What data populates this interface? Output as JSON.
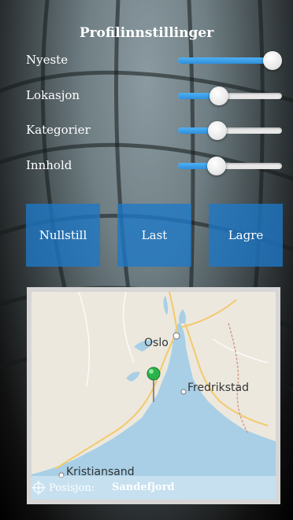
{
  "header": {
    "title": "Profilinnstillinger"
  },
  "settings": [
    {
      "label": "Nyeste",
      "value": 1.0
    },
    {
      "label": "Lokasjon",
      "value": 0.37
    },
    {
      "label": "Kategorier",
      "value": 0.35
    },
    {
      "label": "Innhold",
      "value": 0.34
    }
  ],
  "buttons": {
    "reset": "Nullstill",
    "load": "Last",
    "save": "Lagre"
  },
  "map": {
    "cities": {
      "oslo": "Oslo",
      "fredrikstad": "Fredrikstad",
      "kristiansand": "Kristiansand"
    },
    "position_label": "Posisjon:",
    "position_value": "Sandefjord",
    "pin_color": "#2bb34a",
    "water_color": "#a8cfe6"
  },
  "colors": {
    "accent": "#2f8fdd",
    "button": "#1e78c8"
  }
}
